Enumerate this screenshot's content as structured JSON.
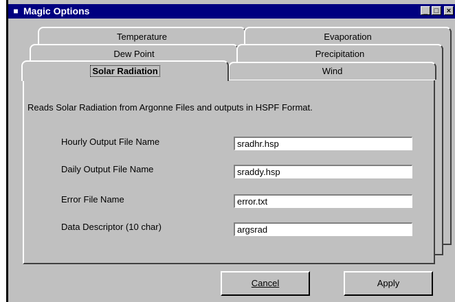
{
  "window": {
    "title": "Magic Options"
  },
  "tabs": {
    "row1": [
      "Temperature",
      "Evaporation"
    ],
    "row2": [
      "Dew Point",
      "Precipitation"
    ],
    "row3": [
      "Solar Radiation",
      "Wind"
    ],
    "active": "Solar Radiation"
  },
  "panel": {
    "description": "Reads Solar Radiation from Argonne Files and outputs in HSPF Format.",
    "fields": [
      {
        "label": "Hourly Output File Name",
        "value": "sradhr.hsp"
      },
      {
        "label": "Daily Output File Name",
        "value": "sraddy.hsp"
      },
      {
        "label": "Error File Name",
        "value": "error.txt"
      },
      {
        "label": "Data Descriptor (10 char)",
        "value": "argsrad"
      }
    ]
  },
  "buttons": {
    "cancel": "Cancel",
    "apply": "Apply"
  },
  "icons": {
    "app": "app-icon",
    "minimize": "minimize-icon",
    "maximize": "maximize-icon",
    "close": "close-icon"
  }
}
